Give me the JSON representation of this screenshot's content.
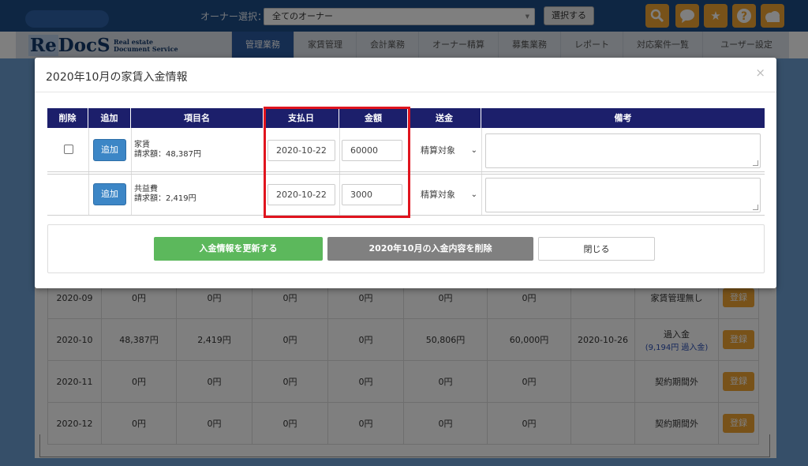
{
  "header": {
    "owner_label": "オーナー選択：",
    "owner_value": "全てのオーナー",
    "select_button": "選択する"
  },
  "toolbar": {
    "icons": [
      "search-icon",
      "chat-icon",
      "star-icon",
      "help-icon",
      "cloud-icon"
    ]
  },
  "logo": {
    "re": "Re",
    "docs": "DocS",
    "line1": "Real estate",
    "line2": "Document Service"
  },
  "nav": {
    "items": [
      "管理業務",
      "家賃管理",
      "会計業務",
      "オーナー精算",
      "募集業務",
      "レポート",
      "対応案件一覧",
      "ユーザー設定"
    ],
    "active": "管理業務"
  },
  "background_table": {
    "rows": [
      {
        "month": "2020-09",
        "c1": "0円",
        "c2": "0円",
        "c3": "0円",
        "c4": "0円",
        "c5": "0円",
        "c6": "0円",
        "date": "",
        "status": "家賃管理無し",
        "sub": "",
        "btn": "登録"
      },
      {
        "month": "2020-10",
        "c1": "48,387円",
        "c2": "2,419円",
        "c3": "0円",
        "c4": "0円",
        "c5": "50,806円",
        "c6": "60,000円",
        "date": "2020-10-26",
        "status": "過入金",
        "sub": "(9,194円 過入金)",
        "btn": "登録"
      },
      {
        "month": "2020-11",
        "c1": "0円",
        "c2": "0円",
        "c3": "0円",
        "c4": "0円",
        "c5": "0円",
        "c6": "0円",
        "date": "",
        "status": "契約期間外",
        "sub": "",
        "btn": "登録"
      },
      {
        "month": "2020-12",
        "c1": "0円",
        "c2": "0円",
        "c3": "0円",
        "c4": "0円",
        "c5": "0円",
        "c6": "0円",
        "date": "",
        "status": "契約期間外",
        "sub": "",
        "btn": "登録"
      }
    ]
  },
  "modal": {
    "title": "2020年10月の家賃入金情報",
    "close": "×",
    "columns": [
      "削除",
      "追加",
      "項目名",
      "支払日",
      "金額",
      "送金",
      "備考"
    ],
    "rows": [
      {
        "add_label": "追加",
        "item": "家賃",
        "billed": "請求額：48,387円",
        "date": "2020-10-22",
        "amount": "60000",
        "remit": "精算対象",
        "note": ""
      },
      {
        "add_label": "追加",
        "item": "共益費",
        "billed": "請求額：2,419円",
        "date": "2020-10-22",
        "amount": "3000",
        "remit": "精算対象",
        "note": ""
      }
    ],
    "buttons": {
      "update": "入金情報を更新する",
      "delete": "2020年10月の入金内容を削除",
      "close": "閉じる"
    }
  }
}
